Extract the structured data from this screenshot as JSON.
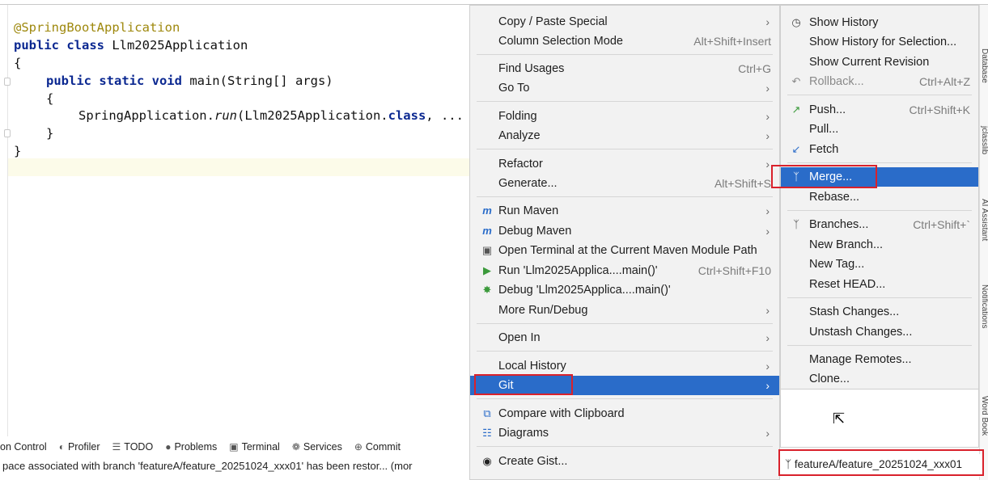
{
  "editor": {
    "lines": [
      {
        "annotation": "@SpringBootApplication"
      },
      {
        "kw1": "public class",
        "rest": " Llm2025Application"
      },
      {
        "brace": "{"
      },
      {
        "kw1": "public static void",
        "rest": " main(String[] args)"
      },
      {
        "brace": "{"
      },
      {
        "pre": "SpringApplication.",
        "ital": "run",
        "mid": "(Llm2025Application.",
        "kw": "class",
        "post": ", ..."
      },
      {
        "brace": "}"
      },
      {
        "brace": "}"
      }
    ]
  },
  "toolbar": {
    "items": [
      {
        "label": "on Control",
        "icon": ""
      },
      {
        "label": "Profiler",
        "icon": "profiler-icon"
      },
      {
        "label": "TODO",
        "icon": "list-icon"
      },
      {
        "label": "Problems",
        "icon": "problems-icon"
      },
      {
        "label": "Terminal",
        "icon": "terminal-icon"
      },
      {
        "label": "Services",
        "icon": "services-icon"
      },
      {
        "label": "Commit",
        "icon": "commit-icon"
      }
    ],
    "status": "pace associated with branch 'featureA/feature_20251024_xxx01' has been restor... (mor"
  },
  "context_menu": {
    "items": [
      {
        "label": "Copy / Paste Special",
        "shortcut": "",
        "submenu": true
      },
      {
        "label": "Column Selection Mode",
        "shortcut": "Alt+Shift+Insert",
        "submenu": false
      },
      {
        "label": "Find Usages",
        "shortcut": "Ctrl+G",
        "submenu": false
      },
      {
        "label": "Go To",
        "shortcut": "",
        "submenu": true
      },
      {
        "label": "Folding",
        "shortcut": "",
        "submenu": true
      },
      {
        "label": "Analyze",
        "shortcut": "",
        "submenu": true
      },
      {
        "label": "Refactor",
        "shortcut": "",
        "submenu": true
      },
      {
        "label": "Generate...",
        "shortcut": "Alt+Shift+S",
        "submenu": false
      },
      {
        "label": "Run Maven",
        "shortcut": "",
        "submenu": true
      },
      {
        "label": "Debug Maven",
        "shortcut": "",
        "submenu": true
      },
      {
        "label": "Open Terminal at the Current Maven Module Path",
        "shortcut": "",
        "submenu": false
      },
      {
        "label": "Run 'Llm2025Applica....main()'",
        "shortcut": "Ctrl+Shift+F10",
        "submenu": false
      },
      {
        "label": "Debug 'Llm2025Applica....main()'",
        "shortcut": "",
        "submenu": false
      },
      {
        "label": "More Run/Debug",
        "shortcut": "",
        "submenu": true
      },
      {
        "label": "Open In",
        "shortcut": "",
        "submenu": true
      },
      {
        "label": "Local History",
        "shortcut": "",
        "submenu": true
      },
      {
        "label": "Git",
        "shortcut": "",
        "submenu": true
      },
      {
        "label": "Compare with Clipboard",
        "shortcut": "",
        "submenu": false
      },
      {
        "label": "Diagrams",
        "shortcut": "",
        "submenu": true
      },
      {
        "label": "Create Gist...",
        "shortcut": "",
        "submenu": false
      }
    ]
  },
  "git_submenu": {
    "items": [
      {
        "label": "Show History",
        "shortcut": ""
      },
      {
        "label": "Show History for Selection...",
        "shortcut": ""
      },
      {
        "label": "Show Current Revision",
        "shortcut": ""
      },
      {
        "label": "Rollback...",
        "shortcut": "Ctrl+Alt+Z"
      },
      {
        "label": "Push...",
        "shortcut": "Ctrl+Shift+K"
      },
      {
        "label": "Pull...",
        "shortcut": ""
      },
      {
        "label": "Fetch",
        "shortcut": ""
      },
      {
        "label": "Merge...",
        "shortcut": ""
      },
      {
        "label": "Rebase...",
        "shortcut": ""
      },
      {
        "label": "Branches...",
        "shortcut": "Ctrl+Shift+`"
      },
      {
        "label": "New Branch...",
        "shortcut": ""
      },
      {
        "label": "New Tag...",
        "shortcut": ""
      },
      {
        "label": "Reset HEAD...",
        "shortcut": ""
      },
      {
        "label": "Stash Changes...",
        "shortcut": ""
      },
      {
        "label": "Unstash Changes...",
        "shortcut": ""
      },
      {
        "label": "Manage Remotes...",
        "shortcut": ""
      },
      {
        "label": "Clone...",
        "shortcut": ""
      }
    ]
  },
  "branch_widget": {
    "label": "featureA/feature_20251024_xxx01"
  },
  "side_strip": {
    "labels": [
      "Database",
      "jclasslib",
      "AI Assistant",
      "Notifications",
      "Word Book"
    ]
  },
  "colors": {
    "selection": "#2a6cc9",
    "highlight_box": "#d9212b",
    "keyword": "#0b2891",
    "annotation": "#9e880d"
  }
}
